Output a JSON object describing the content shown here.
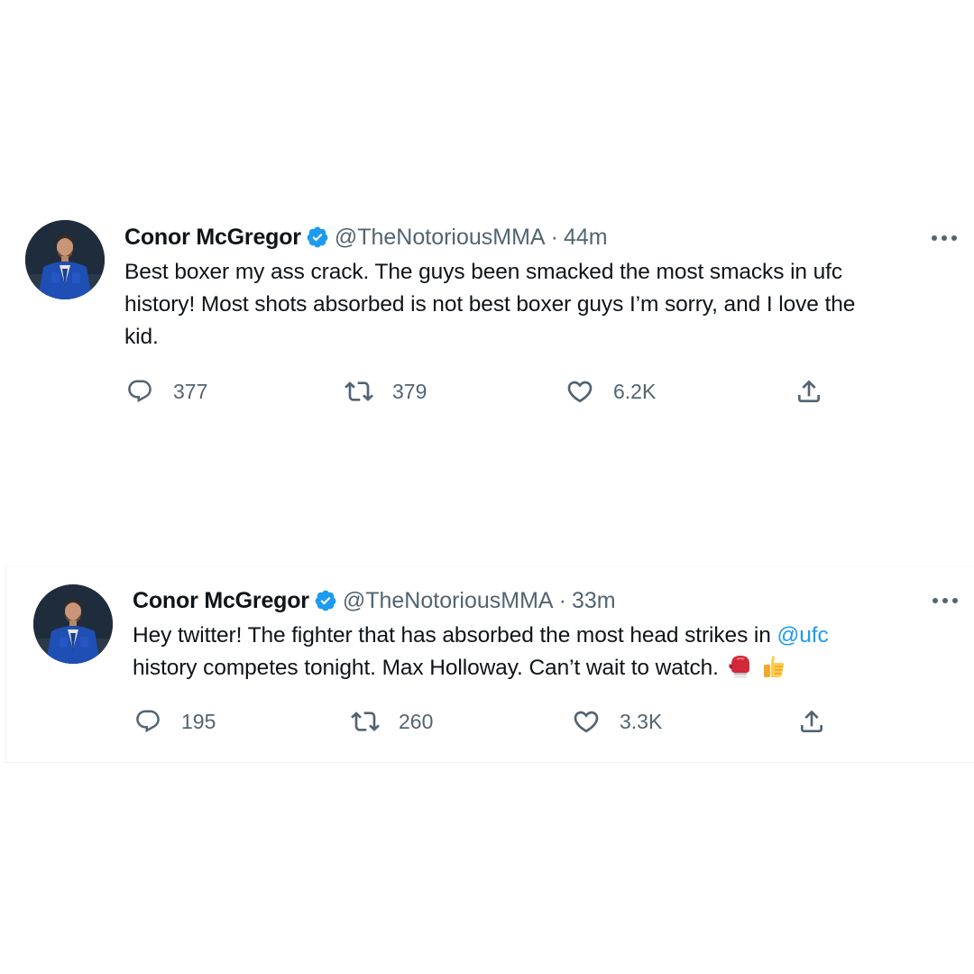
{
  "colors": {
    "text": "#0f1419",
    "secondary": "#536471",
    "accent": "#1d9bf0",
    "verified": "#1d9bf0"
  },
  "tweets": [
    {
      "author_name": "Conor McGregor",
      "handle": "@TheNotoriousMMA",
      "separator": "·",
      "time": "44m",
      "text_lines": [
        "Best boxer my ass crack. The guys been smacked the most smacks in ufc",
        "history! Most shots absorbed is not best boxer guys I’m sorry, and I love the",
        "kid."
      ],
      "reply_count": "377",
      "retweet_count": "379",
      "like_count": "6.2K",
      "icons": [
        "verified-badge-icon",
        "more-icon",
        "reply-icon",
        "retweet-icon",
        "like-icon",
        "share-icon"
      ]
    },
    {
      "author_name": "Conor McGregor",
      "handle": "@TheNotoriousMMA",
      "separator": "·",
      "time": "33m",
      "text_line1_before": "Hey twitter! The fighter that has absorbed the most head strikes in ",
      "mention": "@ufc",
      "text_line2": "history competes tonight. Max Holloway. Can’t wait to watch.",
      "emojis": [
        "boxing-glove-icon",
        "thumbs-up-icon"
      ],
      "reply_count": "195",
      "retweet_count": "260",
      "like_count": "3.3K",
      "icons": [
        "verified-badge-icon",
        "more-icon",
        "reply-icon",
        "retweet-icon",
        "like-icon",
        "share-icon"
      ]
    }
  ]
}
